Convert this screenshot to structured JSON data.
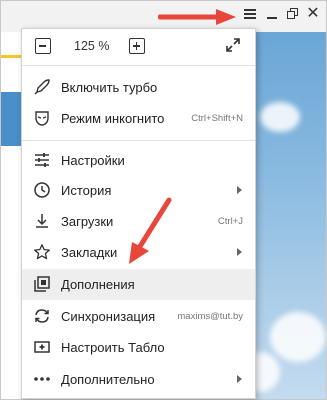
{
  "zoom": {
    "value": "125 %"
  },
  "menu_items": [
    {
      "label": "Включить турбо",
      "shortcut": "",
      "icon": "rocket-icon"
    },
    {
      "label": "Режим инкогнито",
      "shortcut": "Ctrl+Shift+N",
      "icon": "incognito-mask-icon"
    },
    {
      "label": "Настройки",
      "shortcut": "",
      "icon": "settings-sliders-icon"
    },
    {
      "label": "История",
      "shortcut": "",
      "icon": "clock-icon"
    },
    {
      "label": "Загрузки",
      "shortcut": "Ctrl+J",
      "icon": "download-icon"
    },
    {
      "label": "Закладки",
      "shortcut": "",
      "icon": "star-icon"
    },
    {
      "label": "Дополнения",
      "shortcut": "",
      "icon": "extensions-icon"
    },
    {
      "label": "Синхронизация",
      "shortcut": "maxims@tut.by",
      "icon": "sync-icon"
    },
    {
      "label": "Настроить Табло",
      "shortcut": "",
      "icon": "add-tableau-icon"
    },
    {
      "label": "Дополнительно",
      "shortcut": "",
      "icon": "more-dots-icon"
    }
  ],
  "colors": {
    "arrow": "#e8463a",
    "hover": "#eeeeee",
    "sky": "#86b8df"
  }
}
